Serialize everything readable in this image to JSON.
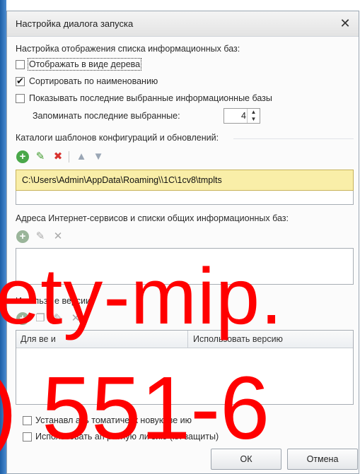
{
  "dialog": {
    "title": "Настройка диалога запуска",
    "close_glyph": "✕"
  },
  "display": {
    "heading": "Настройка отображения списка информационных баз:",
    "tree_label": "Отображать в виде дерева",
    "tree_checked": false,
    "sort_label": "Сортировать по наименованию",
    "sort_checked": true,
    "recent_label": "Показывать последние выбранные информационные базы",
    "recent_checked": false,
    "remember_label": "Запоминать последние выбранные:",
    "remember_value": "4"
  },
  "templates": {
    "heading": "Каталоги шаблонов конфигураций и обновлений:",
    "path": "C:\\Users\\Admin\\AppData\\Roaming\\\\1C\\1cv8\\tmplts",
    "icons": [
      "add-icon",
      "edit-icon",
      "delete-icon",
      "move-up-icon",
      "move-down-icon"
    ]
  },
  "internet": {
    "heading": "Адреса Интернет-сервисов и списки общих информационных баз:",
    "icons": [
      "add-icon",
      "edit-icon",
      "delete-icon"
    ]
  },
  "versions": {
    "heading_visible": "И   пользу       е версии:",
    "col_for_version": "Для ве   и",
    "col_use_version": "Использовать версию"
  },
  "bottom": {
    "auto_install_label": "Устанавл           ать   томатическ      новую ве  ию",
    "auto_install_checked": false,
    "hw_license_label": "Использовать ап      ратную ли      зию (кл     защиты)",
    "hw_license_checked": false
  },
  "buttons": {
    "ok": "ОК",
    "cancel": "Отмена"
  },
  "watermark": {
    "line1": "ety-mip.",
    "line2": ") 551-6"
  },
  "colors": {
    "path_highlight": "#f9eea8",
    "add_green": "#4aa84a",
    "delete_red": "#d9322e",
    "watermark_red": "#ff0000"
  }
}
